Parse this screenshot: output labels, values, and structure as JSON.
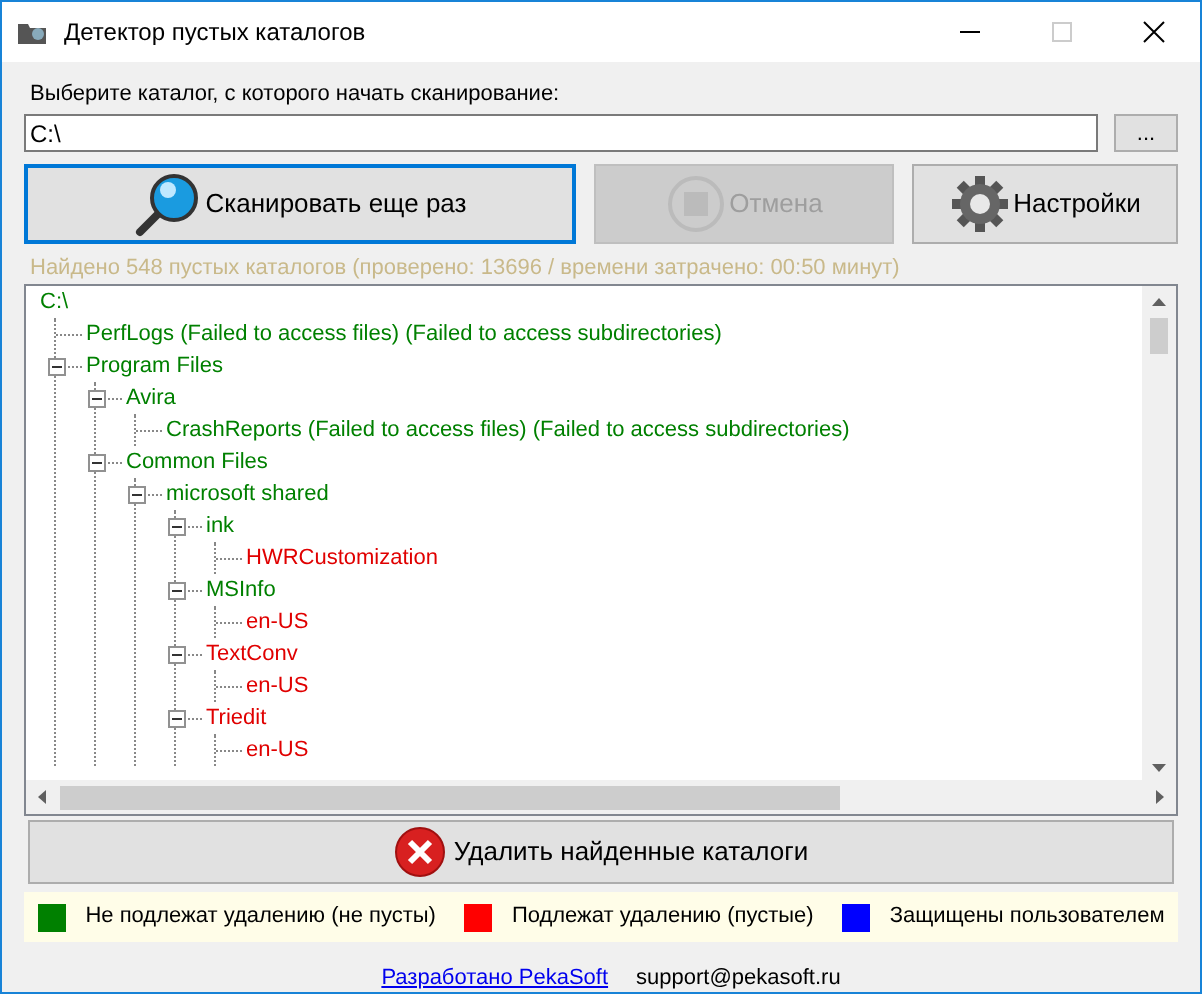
{
  "window": {
    "title": "Детектор пустых каталогов"
  },
  "folder_label": "Выберите каталог, с которого начать сканирование:",
  "folder_field": {
    "value": "C:\\"
  },
  "browse_button": "...",
  "buttons": [
    {
      "kind": "scan",
      "label": "Сканировать еще раз",
      "disabled": false,
      "focused": true
    },
    {
      "kind": "cancel",
      "label": "Отмена",
      "disabled": true,
      "focused": false
    },
    {
      "kind": "settings",
      "label": "Настройки",
      "disabled": false,
      "focused": false
    }
  ],
  "status": "Найдено 548 пустых каталогов (проверено: 13696 / времени затрачено: 00:50 минут)",
  "tree": [
    {
      "label": "C:\\",
      "color": "#008000",
      "children": [
        {
          "label": "PerfLogs (Failed to access files) (Failed to access subdirectories)",
          "color": "#008000"
        },
        {
          "label": "Program Files",
          "color": "#008000",
          "expanded": true,
          "children": [
            {
              "label": "Avira",
              "color": "#008000",
              "expanded": true,
              "children": [
                {
                  "label": "CrashReports (Failed to access files) (Failed to access subdirectories)",
                  "color": "#008000"
                }
              ]
            },
            {
              "label": "Common Files",
              "color": "#008000",
              "expanded": true,
              "children": [
                {
                  "label": "microsoft shared",
                  "color": "#008000",
                  "expanded": true,
                  "children": [
                    {
                      "label": "ink",
                      "color": "#008000",
                      "expanded": true,
                      "children": [
                        {
                          "label": "HWRCustomization",
                          "color": "#e00000"
                        }
                      ]
                    },
                    {
                      "label": "MSInfo",
                      "color": "#008000",
                      "expanded": true,
                      "children": [
                        {
                          "label": "en-US",
                          "color": "#e00000"
                        }
                      ]
                    },
                    {
                      "label": "TextConv",
                      "color": "#e00000",
                      "expanded": true,
                      "children": [
                        {
                          "label": "en-US",
                          "color": "#e00000"
                        }
                      ]
                    },
                    {
                      "label": "Triedit",
                      "color": "#e00000",
                      "expanded": true,
                      "children": [
                        {
                          "label": "en-US",
                          "color": "#e00000"
                        }
                      ]
                    }
                  ]
                }
              ]
            }
          ]
        }
      ]
    }
  ],
  "delete_button": "Удалить найденные  каталоги",
  "legend": [
    {
      "label": "Не подлежат удалению (не пусты)",
      "color": "#008000"
    },
    {
      "label": "Подлежат удалению (пустые)",
      "color": "#ff0000"
    },
    {
      "label": "Защищены пользователем",
      "color": "#0000ff"
    }
  ],
  "footer": {
    "link": "Разработано PekaSoft",
    "email": "support@pekasoft.ru"
  }
}
